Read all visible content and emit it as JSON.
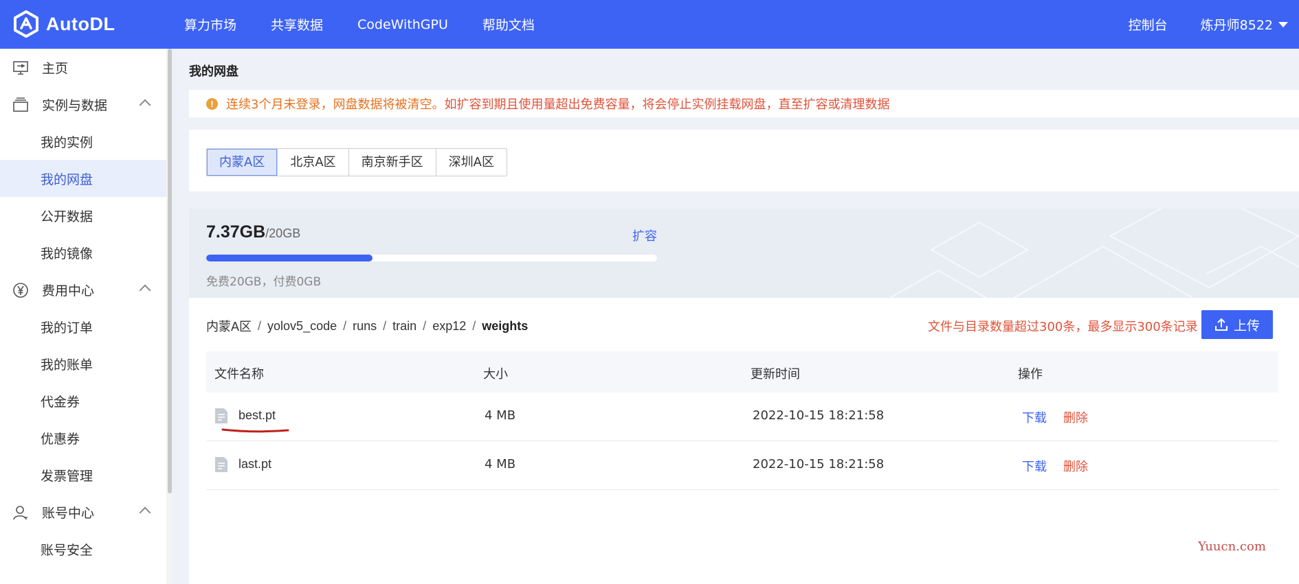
{
  "brand": {
    "name": "AutoDL",
    "accent": "#3d63f5"
  },
  "nav": {
    "items": [
      "算力市场",
      "共享数据",
      "CodeWithGPU",
      "帮助文档"
    ],
    "console": "控制台",
    "user": "炼丹师8522"
  },
  "sidebar": {
    "home": "主页",
    "instances_group": "实例与数据",
    "my_instances": "我的实例",
    "my_disk": "我的网盘",
    "public_data": "公开数据",
    "my_images": "我的镜像",
    "billing_group": "费用中心",
    "my_orders": "我的订单",
    "my_bills": "我的账单",
    "vouchers": "代金券",
    "coupons": "优惠券",
    "invoices": "发票管理",
    "account_group": "账号中心",
    "account_security": "账号安全"
  },
  "page": {
    "title": "我的网盘"
  },
  "notice": {
    "part1": "连续3个月未登录，网盘数据将被清空。",
    "part2": "如扩容到期且使用量超出免费容量，将会停止实例挂载网盘，直至扩容或清理数据"
  },
  "regions": {
    "tabs": [
      "内蒙A区",
      "北京A区",
      "南京新手区",
      "深圳A区"
    ],
    "active": "内蒙A区"
  },
  "usage": {
    "used": "7.37GB",
    "total": "/20GB",
    "used_fraction": 0.3685,
    "expand_label": "扩容",
    "detail": "免费20GB，付费0GB"
  },
  "breadcrumb": [
    "内蒙A区",
    "yolov5_code",
    "runs",
    "train",
    "exp12",
    "weights"
  ],
  "limit_notice": "文件与目录数量超过300条，最多显示300条记录",
  "upload_label": "上传",
  "table": {
    "headers": {
      "name": "文件名称",
      "size": "大小",
      "updated": "更新时间",
      "actions": "操作"
    },
    "rows": [
      {
        "name": "best.pt",
        "size": "4 MB",
        "updated": "2022-10-15 18:21:58",
        "download": "下载",
        "delete": "删除"
      },
      {
        "name": "last.pt",
        "size": "4 MB",
        "updated": "2022-10-15 18:21:58",
        "download": "下载",
        "delete": "删除"
      }
    ]
  },
  "watermark": "Yuucn.com"
}
